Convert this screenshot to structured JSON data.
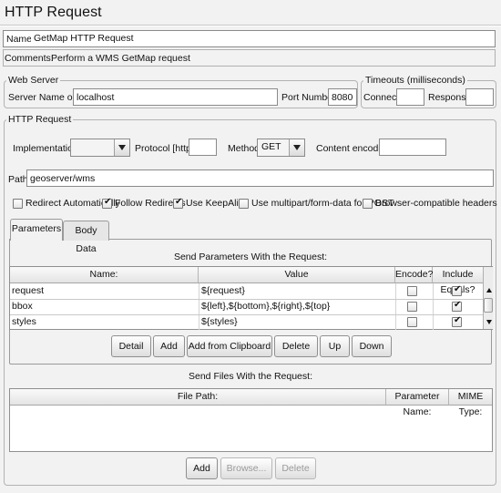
{
  "header": {
    "title": "HTTP Request"
  },
  "name_row": {
    "label": "Name:",
    "value": "GetMap HTTP Request"
  },
  "comments_row": {
    "label": "Comments:",
    "value": "Perform a WMS GetMap request"
  },
  "web_server": {
    "legend": "Web Server",
    "server_label": "Server Name or IP:",
    "server_value": "localhost",
    "port_label": "Port Number:",
    "port_value": "8080"
  },
  "timeouts": {
    "legend": "Timeouts (milliseconds)",
    "connect_label": "Connect:",
    "connect_value": "",
    "response_label": "Response:",
    "response_value": ""
  },
  "http_request": {
    "legend": "HTTP Request",
    "implementation_label": "Implementation:",
    "implementation_value": "",
    "protocol_label": "Protocol [http]:",
    "protocol_value": "",
    "method_label": "Method:",
    "method_value": "GET",
    "encoding_label": "Content encoding:",
    "encoding_value": "",
    "path_label": "Path:",
    "path_value": "geoserver/wms"
  },
  "options": [
    {
      "label": "Redirect Automatically",
      "checked": false
    },
    {
      "label": "Follow Redirects",
      "checked": true
    },
    {
      "label": "Use KeepAlive",
      "checked": true
    },
    {
      "label": "Use multipart/form-data for POST",
      "checked": false
    },
    {
      "label": "Browser-compatible headers",
      "checked": false
    }
  ],
  "tabs": [
    {
      "label": "Parameters",
      "active": true
    },
    {
      "label": "Body Data",
      "active": false
    }
  ],
  "parameters": {
    "title": "Send Parameters With the Request:",
    "columns": [
      "Name:",
      "Value",
      "Encode?",
      "Include Equals?"
    ],
    "rows": [
      {
        "name": "request",
        "value": "${request}",
        "encode": false,
        "include_equals": true
      },
      {
        "name": "bbox",
        "value": "${left},${bottom},${right},${top}",
        "encode": false,
        "include_equals": true
      },
      {
        "name": "styles",
        "value": "${styles}",
        "encode": false,
        "include_equals": true
      }
    ],
    "buttons": [
      "Detail",
      "Add",
      "Add from Clipboard",
      "Delete",
      "Up",
      "Down"
    ]
  },
  "files": {
    "title": "Send Files With the Request:",
    "columns": [
      "File Path:",
      "Parameter Name:",
      "MIME Type:"
    ],
    "buttons": [
      {
        "label": "Add",
        "enabled": true
      },
      {
        "label": "Browse...",
        "enabled": false
      },
      {
        "label": "Delete",
        "enabled": false
      }
    ]
  }
}
